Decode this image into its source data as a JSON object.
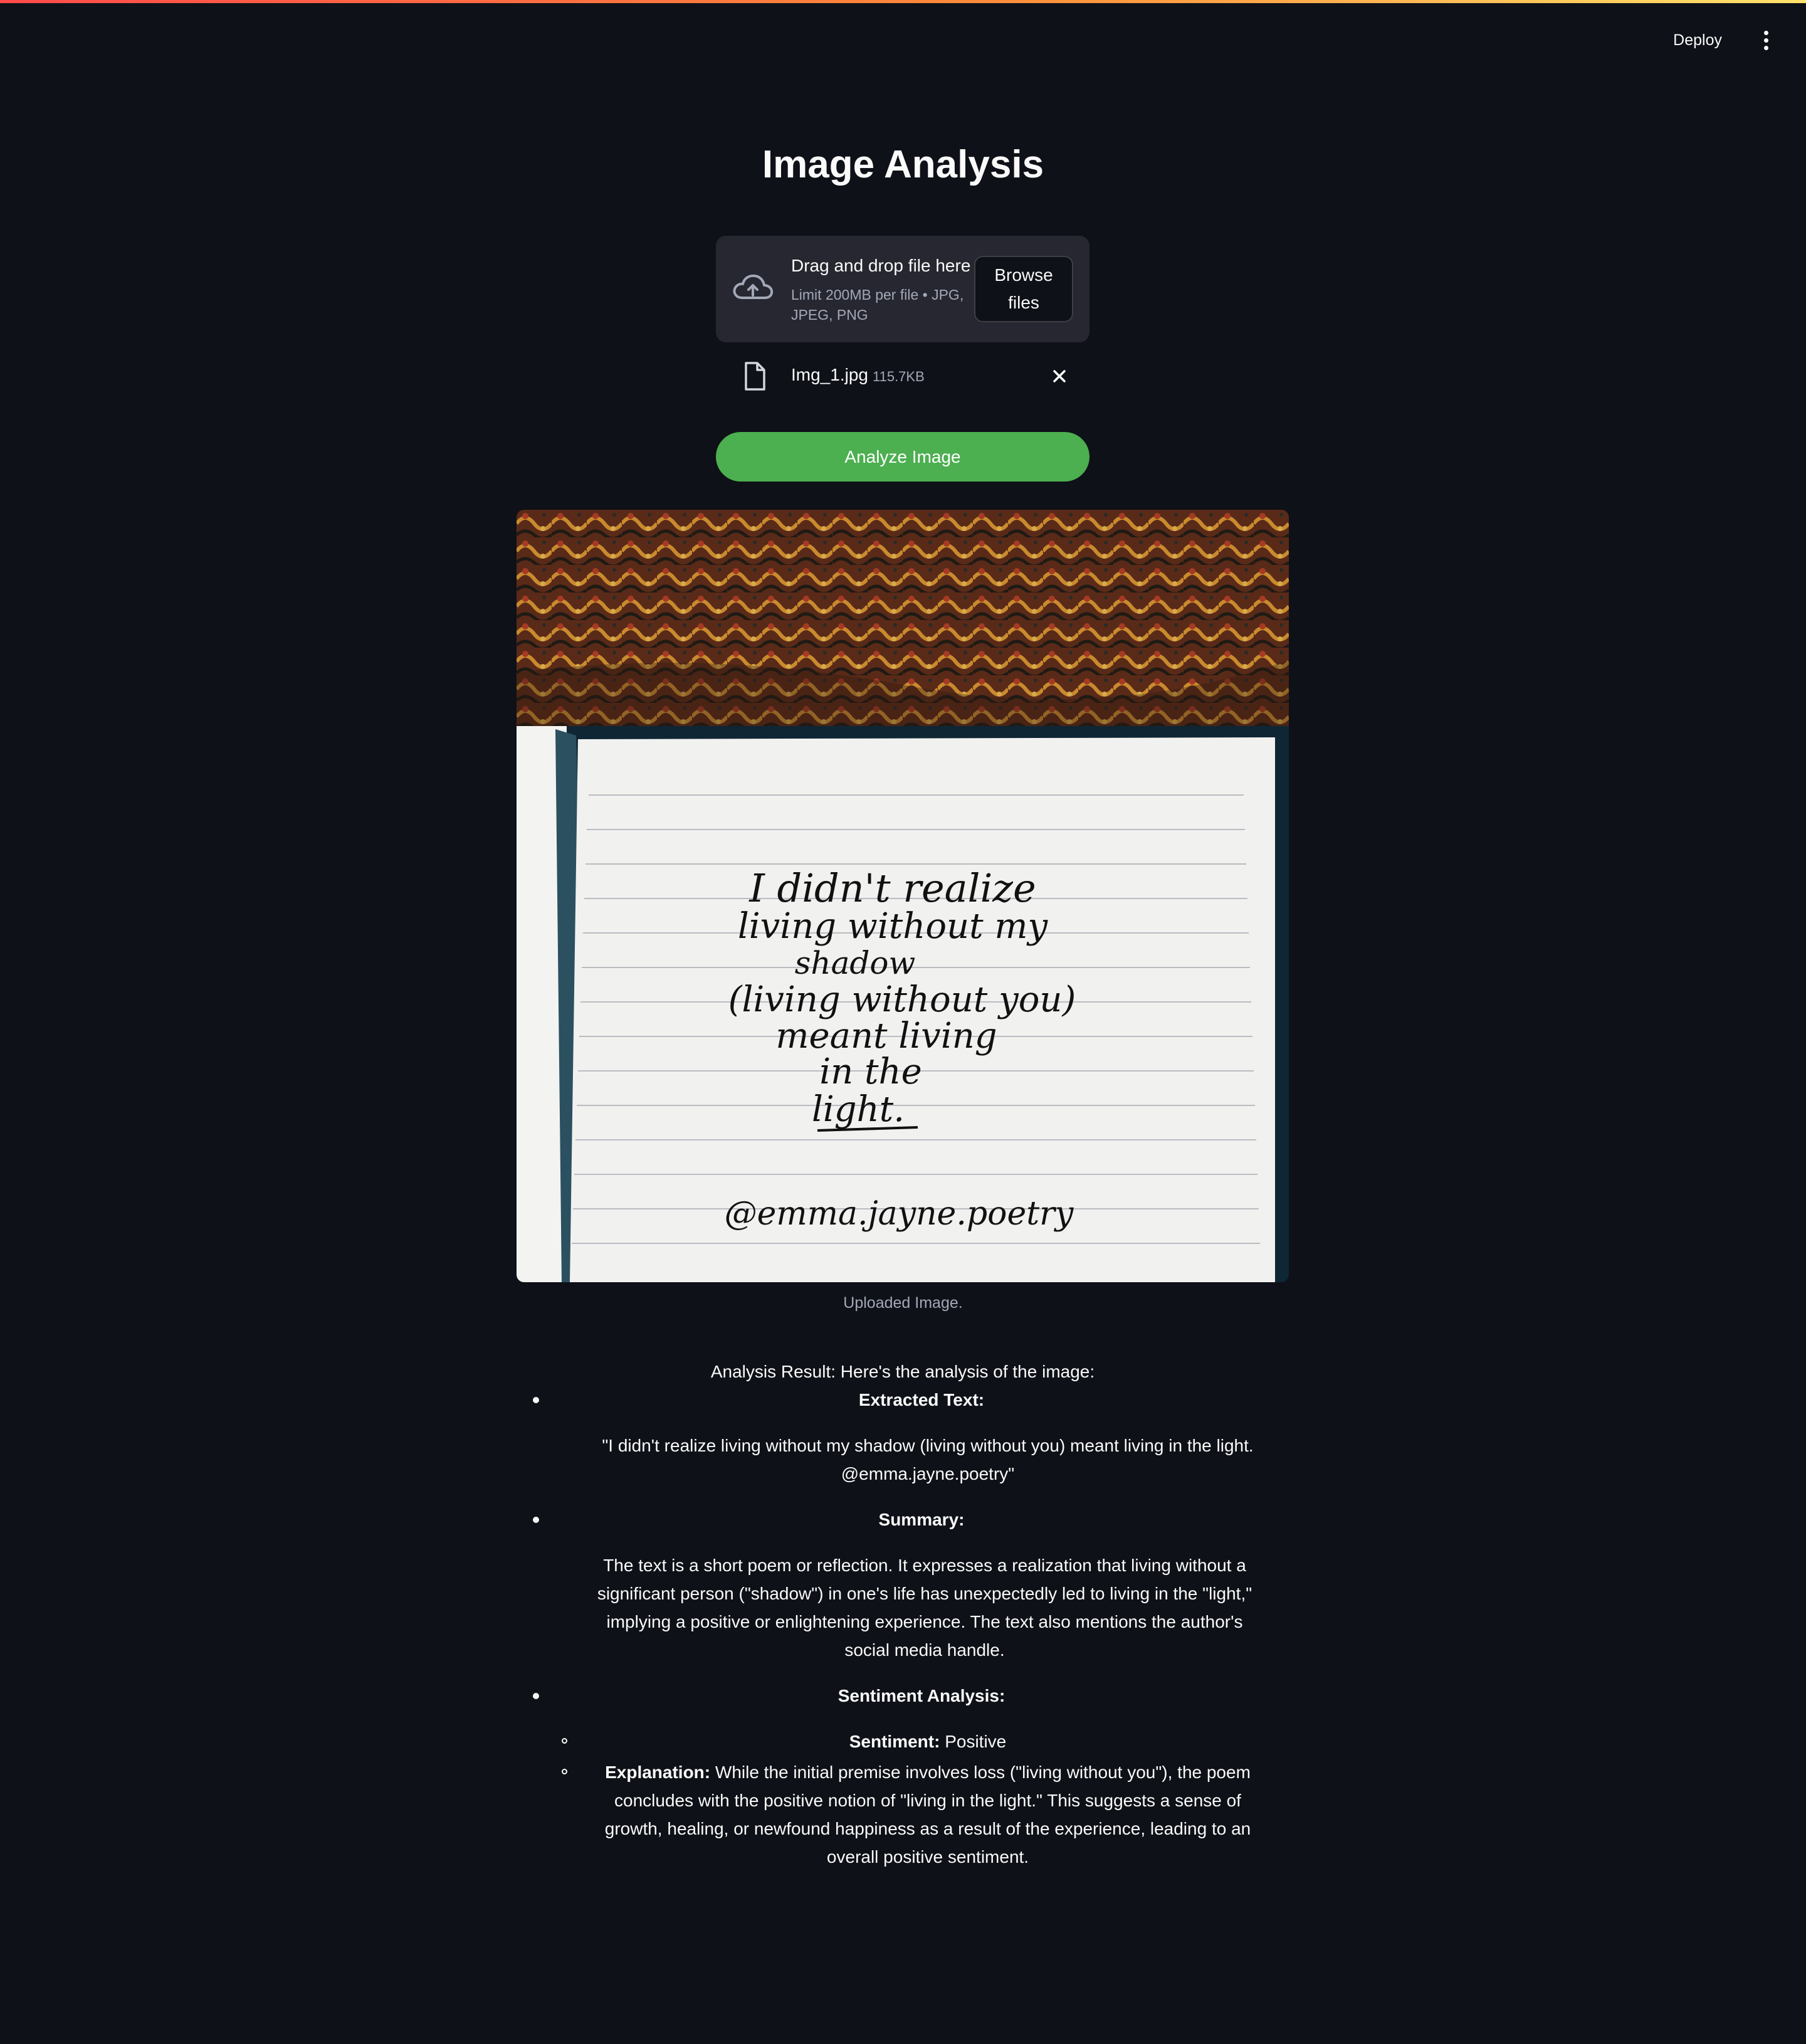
{
  "app": {
    "deploy_label": "Deploy",
    "menu_icon": "kebab-menu-icon",
    "accent_colors": [
      "#ff4b4b",
      "#ffe36a"
    ]
  },
  "page": {
    "title": "Image Analysis"
  },
  "uploader": {
    "icon": "cloud-upload-icon",
    "drag_text": "Drag and drop file here",
    "limit_text": "Limit 200MB per file • JPG, JPEG, PNG",
    "browse_label": "Browse files"
  },
  "file": {
    "icon": "file-icon",
    "name": "Img_1.jpg",
    "size": "115.7KB",
    "remove_icon": "close-icon"
  },
  "analyze": {
    "label": "Analyze Image",
    "color": "#4caf50"
  },
  "image": {
    "caption": "Uploaded Image.",
    "handwritten_text": "I didn't realize living without my shadow (living without you) meant living in the light. @emma.jayne.poetry"
  },
  "result": {
    "intro": "Analysis Result: Here's the analysis of the image:",
    "extracted_heading": "Extracted Text:",
    "extracted_text": "\"I didn't realize living without my shadow (living without you) meant living in the light. @emma.jayne.poetry\"",
    "summary_heading": "Summary:",
    "summary_text": "The text is a short poem or reflection. It expresses a realization that living without a significant person (\"shadow\") in one's life has unexpectedly led to living in the \"light,\" implying a positive or enlightening experience. The text also mentions the author's social media handle.",
    "sentiment_heading": "Sentiment Analysis:",
    "sentiment_label": "Sentiment:",
    "sentiment_value": "Positive",
    "explanation_label": "Explanation:",
    "explanation_text": "While the initial premise involves loss (\"living without you\"), the poem concludes with the positive notion of \"living in the light.\" This suggests a sense of growth, healing, or newfound happiness as a result of the experience, leading to an overall positive sentiment."
  }
}
